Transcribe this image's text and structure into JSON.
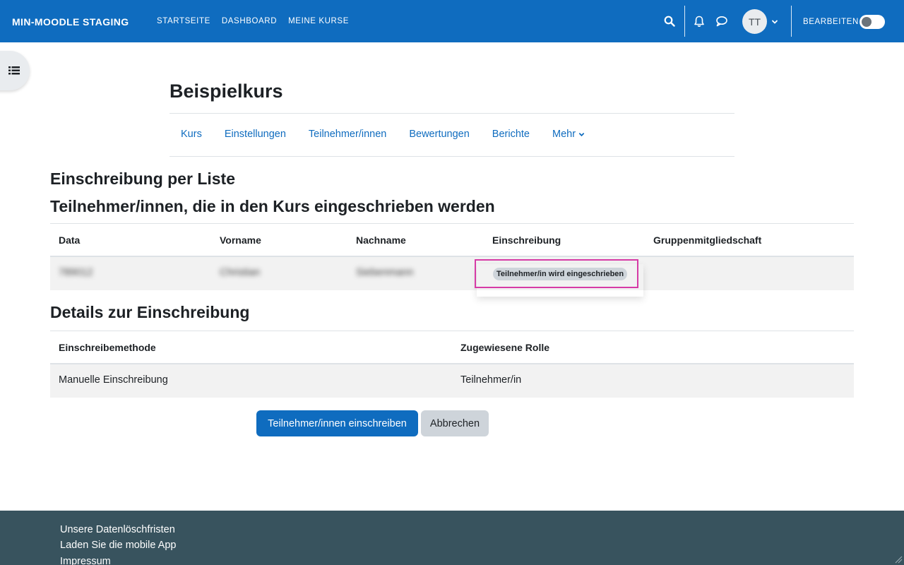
{
  "navbar": {
    "brand": "MIN-MOODLE STAGING",
    "links": [
      "STARTSEITE",
      "DASHBOARD",
      "MEINE KURSE"
    ],
    "avatar_initials": "TT",
    "edit_label": "BEARBEITEN",
    "accent": "#0f6cbf"
  },
  "course": {
    "title": "Beispielkurs",
    "tabs": [
      "Kurs",
      "Einstellungen",
      "Teilnehmer/innen",
      "Bewertungen",
      "Berichte",
      "Mehr"
    ]
  },
  "page": {
    "heading1": "Einschreibung per Liste",
    "heading2": "Teilnehmer/innen, die in den Kurs eingeschrieben werden",
    "heading3": "Details zur Einschreibung"
  },
  "participants_table": {
    "headers": [
      "Data",
      "Vorname",
      "Nachname",
      "Einschreibung",
      "Gruppenmitgliedschaft"
    ],
    "rows": [
      {
        "data": "789012",
        "vorname": "Christian",
        "nachname": "Siebenmann",
        "einschreibung": "Teilnehmer/in wird eingeschrieben",
        "gruppe": ""
      }
    ]
  },
  "details_table": {
    "headers": [
      "Einschreibemethode",
      "Zugewiesene Rolle"
    ],
    "rows": [
      {
        "methode": "Manuelle Einschreibung",
        "rolle": "Teilnehmer/in"
      }
    ]
  },
  "actions": {
    "enrol_label": "Teilnehmer/innen einschreiben",
    "cancel_label": "Abbrechen"
  },
  "footer": {
    "links": [
      "Unsere Datenlöschfristen",
      "Laden Sie die mobile App",
      "Impressum"
    ]
  },
  "icons": [
    "search-icon",
    "bell-icon",
    "chat-icon",
    "chevron-down-icon",
    "list-icon"
  ],
  "colors": {
    "highlight": "#d63ba6",
    "footer": "#38535e"
  }
}
